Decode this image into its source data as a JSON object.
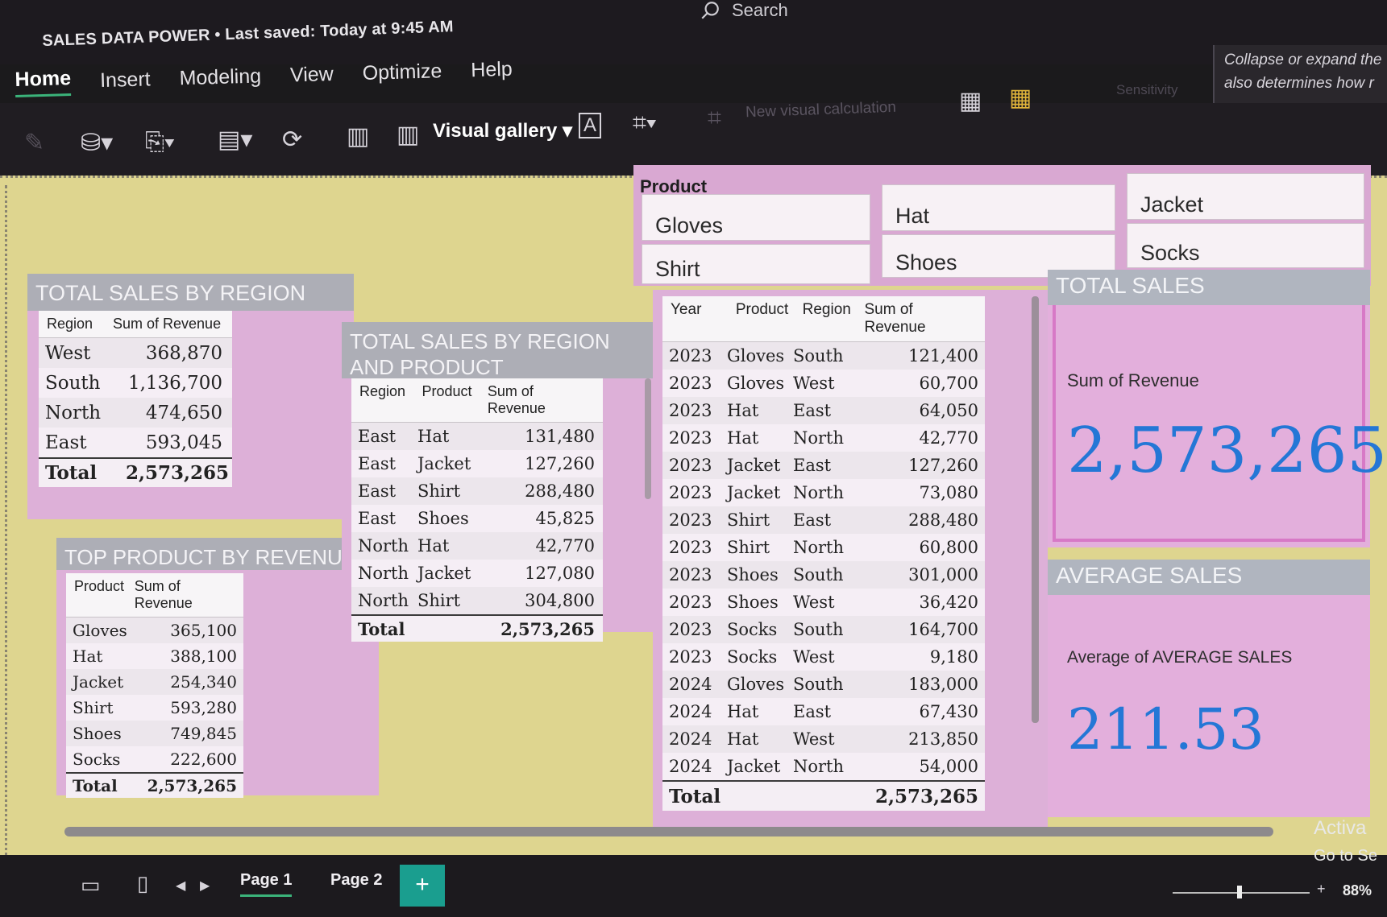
{
  "app": {
    "title": "SALES DATA POWER • Last saved: Today at 9:45 AM",
    "search_label": "Search",
    "collapse_tip_line1": "Collapse or expand the",
    "collapse_tip_line2": "also determines how r"
  },
  "ribbon": {
    "tabs": [
      "Home",
      "Insert",
      "Modeling",
      "View",
      "Optimize",
      "Help"
    ],
    "active_tab": "Home",
    "visual_gallery_label": "Visual gallery",
    "new_visual_calc_label": "New visual calculation",
    "sensitivity_label": "Sensitivity"
  },
  "slicer": {
    "title": "Product",
    "items": [
      "Gloves",
      "Hat",
      "Jacket",
      "Shirt",
      "Shoes",
      "Socks"
    ]
  },
  "region_table": {
    "title": "TOTAL SALES BY REGION",
    "headers": [
      "Region",
      "Sum of Revenue"
    ],
    "rows": [
      [
        "West",
        "368,870"
      ],
      [
        "South",
        "1,136,700"
      ],
      [
        "North",
        "474,650"
      ],
      [
        "East",
        "593,045"
      ]
    ],
    "total": [
      "Total",
      "2,573,265"
    ]
  },
  "top_product_table": {
    "title": "TOP PRODUCT BY REVENUE",
    "headers": [
      "Product",
      "Sum of Revenue"
    ],
    "rows": [
      [
        "Gloves",
        "365,100"
      ],
      [
        "Hat",
        "388,100"
      ],
      [
        "Jacket",
        "254,340"
      ],
      [
        "Shirt",
        "593,280"
      ],
      [
        "Shoes",
        "749,845"
      ],
      [
        "Socks",
        "222,600"
      ]
    ],
    "total": [
      "Total",
      "2,573,265"
    ]
  },
  "region_product_table": {
    "title_line1": "TOTAL SALES BY REGION",
    "title_line2": "AND PRODUCT",
    "headers": [
      "Region",
      "Product",
      "Sum of Revenue"
    ],
    "rows": [
      [
        "East",
        "Hat",
        "131,480"
      ],
      [
        "East",
        "Jacket",
        "127,260"
      ],
      [
        "East",
        "Shirt",
        "288,480"
      ],
      [
        "East",
        "Shoes",
        "45,825"
      ],
      [
        "North",
        "Hat",
        "42,770"
      ],
      [
        "North",
        "Jacket",
        "127,080"
      ],
      [
        "North",
        "Shirt",
        "304,800"
      ]
    ],
    "total": [
      "Total",
      "",
      "2,573,265"
    ]
  },
  "detail_table": {
    "headers": [
      "Year",
      "Product",
      "Region",
      "Sum of Revenue"
    ],
    "rows": [
      [
        "2023",
        "Gloves",
        "South",
        "121,400"
      ],
      [
        "2023",
        "Gloves",
        "West",
        "60,700"
      ],
      [
        "2023",
        "Hat",
        "East",
        "64,050"
      ],
      [
        "2023",
        "Hat",
        "North",
        "42,770"
      ],
      [
        "2023",
        "Jacket",
        "East",
        "127,260"
      ],
      [
        "2023",
        "Jacket",
        "North",
        "73,080"
      ],
      [
        "2023",
        "Shirt",
        "East",
        "288,480"
      ],
      [
        "2023",
        "Shirt",
        "North",
        "60,800"
      ],
      [
        "2023",
        "Shoes",
        "South",
        "301,000"
      ],
      [
        "2023",
        "Shoes",
        "West",
        "36,420"
      ],
      [
        "2023",
        "Socks",
        "South",
        "164,700"
      ],
      [
        "2023",
        "Socks",
        "West",
        "9,180"
      ],
      [
        "2024",
        "Gloves",
        "South",
        "183,000"
      ],
      [
        "2024",
        "Hat",
        "East",
        "67,430"
      ],
      [
        "2024",
        "Hat",
        "West",
        "213,850"
      ],
      [
        "2024",
        "Jacket",
        "North",
        "54,000"
      ]
    ],
    "total": [
      "Total",
      "",
      "",
      "2,573,265"
    ]
  },
  "total_sales_card": {
    "title": "TOTAL SALES",
    "label": "Sum of Revenue",
    "value": "2,573,265"
  },
  "average_sales_card": {
    "title": "AVERAGE SALES",
    "label": "Average of AVERAGE SALES",
    "value": "211.53"
  },
  "footer": {
    "pages": [
      "Page 1",
      "Page 2"
    ],
    "active_page": "Page 1",
    "add_page": "+",
    "zoom": "88%",
    "activate_line1": "Activa",
    "activate_line2": "Go to Se"
  },
  "colors": {
    "canvas": "#ded58f",
    "panel_pink": "#ddb0d8",
    "header_gray": "#adaeb6",
    "value_blue": "#2477d6",
    "active_tab_underline": "#3bb37a",
    "add_page_teal": "#1a9e8f"
  }
}
